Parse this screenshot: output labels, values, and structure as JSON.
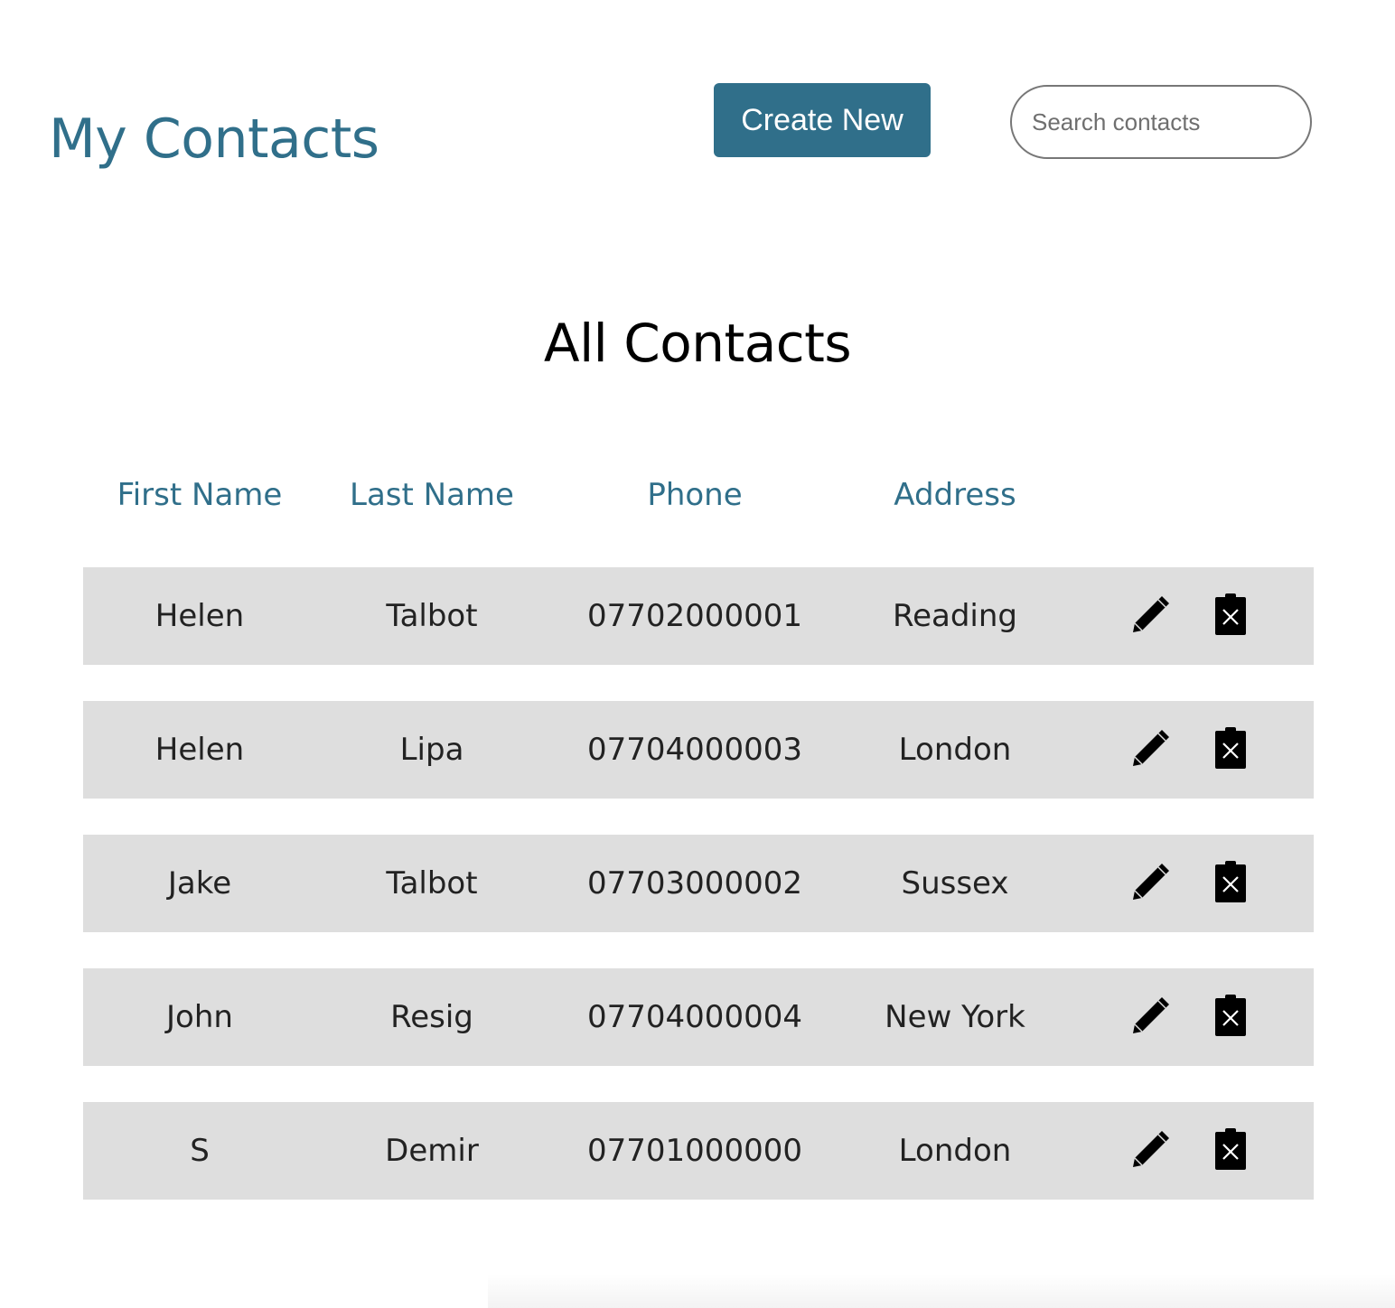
{
  "header": {
    "app_title": "My Contacts",
    "create_label": "Create New",
    "search_placeholder": "Search contacts",
    "search_value": ""
  },
  "section_title": "All Contacts",
  "table": {
    "columns": [
      "First Name",
      "Last Name",
      "Phone",
      "Address"
    ],
    "rows": [
      {
        "first": "Helen",
        "last": "Talbot",
        "phone": "07702000001",
        "address": "Reading"
      },
      {
        "first": "Helen",
        "last": "Lipa",
        "phone": "07704000003",
        "address": "London"
      },
      {
        "first": "Jake",
        "last": "Talbot",
        "phone": "07703000002",
        "address": "Sussex"
      },
      {
        "first": "John",
        "last": "Resig",
        "phone": "07704000004",
        "address": "New York"
      },
      {
        "first": "S",
        "last": "Demir",
        "phone": "07701000000",
        "address": "London"
      }
    ],
    "row_actions": [
      "pencil-icon",
      "trash-icon"
    ]
  },
  "colors": {
    "accent": "#306f8a",
    "row_background": "#dedede",
    "text": "#222222"
  }
}
